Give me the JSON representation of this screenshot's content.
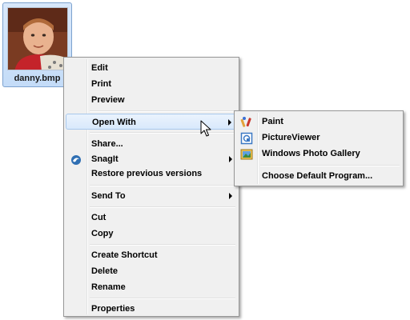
{
  "file": {
    "name": "danny.bmp",
    "thumbnail_icon": "photo-thumbnail-icon"
  },
  "context_menu": {
    "items": [
      {
        "label": "Edit"
      },
      {
        "label": "Print"
      },
      {
        "label": "Preview"
      },
      {
        "label": "Open With",
        "submenu": true,
        "highlighted": true
      },
      {
        "label": "Share..."
      },
      {
        "label": "SnagIt",
        "submenu": true,
        "icon": "snagit-icon"
      },
      {
        "label": "Restore previous versions"
      },
      {
        "label": "Send To",
        "submenu": true
      },
      {
        "label": "Cut"
      },
      {
        "label": "Copy"
      },
      {
        "label": "Create Shortcut"
      },
      {
        "label": "Delete"
      },
      {
        "label": "Rename"
      },
      {
        "label": "Properties"
      }
    ]
  },
  "open_with_submenu": {
    "items": [
      {
        "label": "Paint",
        "icon": "paint-icon"
      },
      {
        "label": "PictureViewer",
        "icon": "pictureviewer-icon"
      },
      {
        "label": "Windows Photo Gallery",
        "icon": "photo-gallery-icon"
      },
      {
        "label": "Choose Default Program..."
      }
    ]
  },
  "colors": {
    "highlight_fill": "#d9e9fc",
    "highlight_border": "#a8c8ec",
    "menu_bg": "#f0f0f0",
    "selection_bg": "#c4dcf8"
  }
}
